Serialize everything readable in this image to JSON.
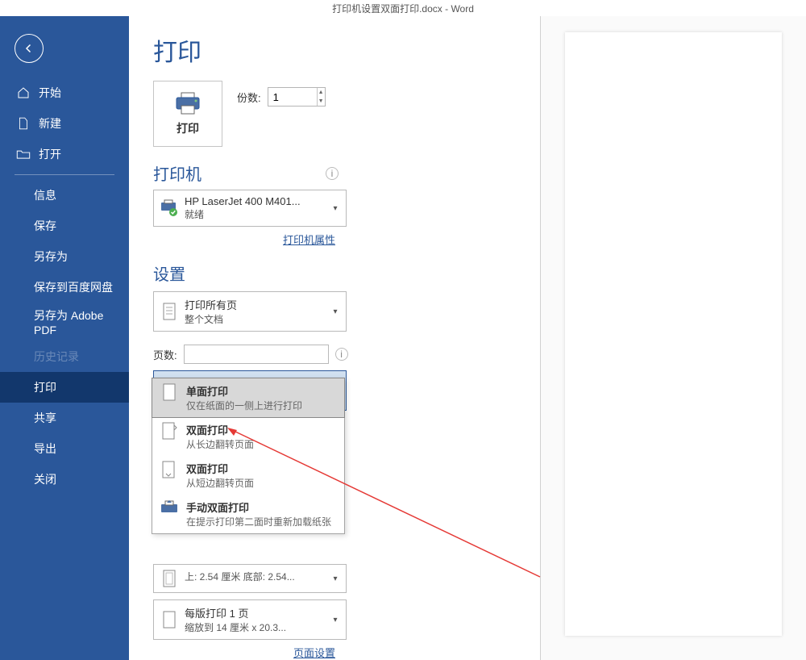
{
  "titlebar": "打印机设置双面打印.docx  -  Word",
  "sidebar": {
    "home": "开始",
    "new": "新建",
    "open": "打开",
    "info": "信息",
    "save": "保存",
    "saveas": "另存为",
    "save_baidu": "保存到百度网盘",
    "save_adobe": "另存为 Adobe PDF",
    "history": "历史记录",
    "print": "打印",
    "share": "共享",
    "export": "导出",
    "close": "关闭"
  },
  "page": {
    "title": "打印",
    "print_button": "打印",
    "copies_label": "份数:",
    "copies_value": "1"
  },
  "printer": {
    "heading": "打印机",
    "name": "HP LaserJet 400 M401...",
    "status": "就绪",
    "properties_link": "打印机属性"
  },
  "settings": {
    "heading": "设置",
    "scope": {
      "title": "打印所有页",
      "sub": "整个文档"
    },
    "pages_label": "页数:",
    "sides": {
      "title": "单面打印",
      "sub": "仅在纸面的一侧上进行..."
    },
    "margins": {
      "title": "",
      "sub": "上: 2.54 厘米 底部: 2.54..."
    },
    "sheets": {
      "title": "每版打印 1 页",
      "sub": "缩放到 14 厘米 x 20.3..."
    },
    "page_setup_link": "页面设置"
  },
  "sides_menu": {
    "opt1": {
      "title": "单面打印",
      "sub": "仅在纸面的一侧上进行打印"
    },
    "opt2": {
      "title": "双面打印",
      "sub": "从长边翻转页面"
    },
    "opt3": {
      "title": "双面打印",
      "sub": "从短边翻转页面"
    },
    "opt4": {
      "title": "手动双面打印",
      "sub": "在提示打印第二面时重新加载纸张"
    }
  }
}
